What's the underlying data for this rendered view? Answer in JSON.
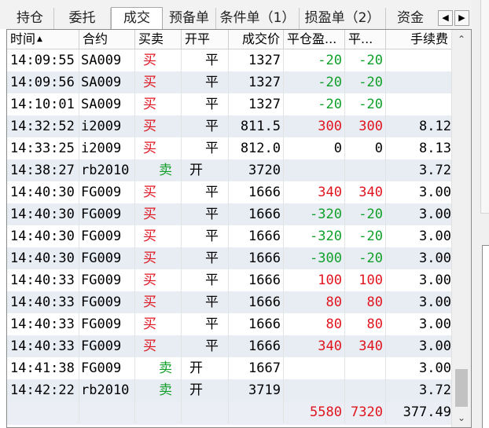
{
  "tabs": [
    "持仓",
    "委托",
    "成交",
    "预备单",
    "条件单（1）",
    "损盈单（2）",
    "资金"
  ],
  "active_tab": "成交",
  "columns": [
    "时间",
    "合约",
    "买卖",
    "开平",
    "成交价",
    "平仓盈...",
    "平...",
    "手续费"
  ],
  "rows": [
    {
      "time": "14:09:55",
      "symbol": "SA009",
      "side": "买",
      "oc": "平",
      "price": "1327",
      "pnl": "-20",
      "pnl2": "-20",
      "fee": ""
    },
    {
      "time": "14:09:56",
      "symbol": "SA009",
      "side": "买",
      "oc": "平",
      "price": "1327",
      "pnl": "-20",
      "pnl2": "-20",
      "fee": ""
    },
    {
      "time": "14:10:01",
      "symbol": "SA009",
      "side": "买",
      "oc": "平",
      "price": "1327",
      "pnl": "-20",
      "pnl2": "-20",
      "fee": ""
    },
    {
      "time": "14:32:52",
      "symbol": "i2009",
      "side": "买",
      "oc": "平",
      "price": "811.5",
      "pnl": "300",
      "pnl2": "300",
      "fee": "8.12"
    },
    {
      "time": "14:33:25",
      "symbol": "i2009",
      "side": "买",
      "oc": "平",
      "price": "812.0",
      "pnl": "0",
      "pnl2": "0",
      "fee": "8.13"
    },
    {
      "time": "14:38:27",
      "symbol": "rb2010",
      "side": "卖",
      "oc": "开",
      "price": "3720",
      "pnl": "",
      "pnl2": "",
      "fee": "3.72"
    },
    {
      "time": "14:40:30",
      "symbol": "FG009",
      "side": "买",
      "oc": "平",
      "price": "1666",
      "pnl": "340",
      "pnl2": "340",
      "fee": "3.00"
    },
    {
      "time": "14:40:30",
      "symbol": "FG009",
      "side": "买",
      "oc": "平",
      "price": "1666",
      "pnl": "-320",
      "pnl2": "-20",
      "fee": "3.00"
    },
    {
      "time": "14:40:30",
      "symbol": "FG009",
      "side": "买",
      "oc": "平",
      "price": "1666",
      "pnl": "-320",
      "pnl2": "-20",
      "fee": "3.00"
    },
    {
      "time": "14:40:30",
      "symbol": "FG009",
      "side": "买",
      "oc": "平",
      "price": "1666",
      "pnl": "-300",
      "pnl2": "-20",
      "fee": "3.00"
    },
    {
      "time": "14:40:33",
      "symbol": "FG009",
      "side": "买",
      "oc": "平",
      "price": "1666",
      "pnl": "100",
      "pnl2": "100",
      "fee": "3.00"
    },
    {
      "time": "14:40:33",
      "symbol": "FG009",
      "side": "买",
      "oc": "平",
      "price": "1666",
      "pnl": "80",
      "pnl2": "80",
      "fee": "3.00"
    },
    {
      "time": "14:40:33",
      "symbol": "FG009",
      "side": "买",
      "oc": "平",
      "price": "1666",
      "pnl": "80",
      "pnl2": "80",
      "fee": "3.00"
    },
    {
      "time": "14:40:33",
      "symbol": "FG009",
      "side": "买",
      "oc": "平",
      "price": "1666",
      "pnl": "340",
      "pnl2": "340",
      "fee": "3.00"
    },
    {
      "time": "14:41:38",
      "symbol": "FG009",
      "side": "卖",
      "oc": "开",
      "price": "1667",
      "pnl": "",
      "pnl2": "",
      "fee": "3.00"
    },
    {
      "time": "14:42:22",
      "symbol": "rb2010",
      "side": "卖",
      "oc": "开",
      "price": "3719",
      "pnl": "",
      "pnl2": "",
      "fee": "3.72"
    }
  ],
  "totals": {
    "pnl": "5580",
    "pnl2": "7320",
    "fee": "377.49"
  },
  "colors": {
    "profit": "#e0141e",
    "loss": "#10a02a",
    "alt_row": "#e8ecf3"
  },
  "icons": [
    "sort-ascending-icon",
    "tab-scroll-left-icon",
    "tab-scroll-right-icon",
    "scroll-up-icon",
    "scroll-down-icon"
  ]
}
